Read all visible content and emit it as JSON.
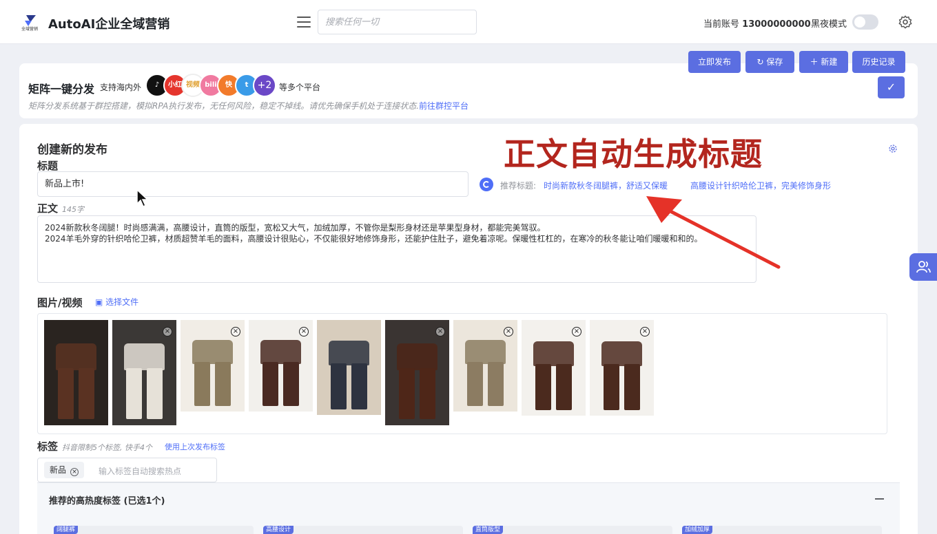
{
  "header": {
    "app_title": "AutoAI企业全域营销",
    "search_placeholder": "搜索任何一切",
    "account_label": "当前账号",
    "account_number": "13000000000",
    "dark_mode_label": "黑夜模式",
    "dark_mode_on": false
  },
  "toolbar": {
    "publish_now": "立即发布",
    "save": "保存",
    "new": "新建",
    "history": "历史记录"
  },
  "matrix": {
    "title": "矩阵一键分发",
    "subtitle_prefix": "支持海内外",
    "subtitle_suffix": "等多个平台",
    "more_count": "+2",
    "description": "矩阵分发系统基于群控搭建，模拟RPA执行发布，无任何风险，稳定不掉线。请优先确保手机处于连接状态.",
    "link": "前往群控平台",
    "platforms": [
      {
        "name": "tiktok-icon",
        "text": "♪",
        "color": "#111111"
      },
      {
        "name": "xiaohongshu-icon",
        "text": "小红",
        "color": "#e5352d"
      },
      {
        "name": "weixin-video-icon",
        "text": "视频",
        "color": "#ffffff"
      },
      {
        "name": "bilibili-icon",
        "text": "bili",
        "color": "#f07aa0"
      },
      {
        "name": "kuaishou-icon",
        "text": "快",
        "color": "#f27b2b"
      },
      {
        "name": "twitter-icon",
        "text": "t",
        "color": "#3a9be8"
      },
      {
        "name": "more-platforms-icon",
        "text": "+2",
        "color": "#6b48c7"
      }
    ]
  },
  "form": {
    "heading": "创建新的发布",
    "title_label": "标题",
    "title_value": "新品上市!",
    "recommend_label": "推荐标题:",
    "recommended_titles": [
      "时尚新款秋冬阔腿裤，舒适又保暖",
      "高腰设计针织哈伦卫裤，完美修饰身形"
    ],
    "body_label": "正文",
    "body_count": "145字",
    "body_lines": [
      "2024新款秋冬阔腿！时尚感满满，高腰设计，直筒的版型，宽松又大气，加绒加厚，不管你是梨形身材还是苹果型身材，都能完美驾驭。",
      "2024羊毛外穿的针织哈伦卫裤，材质超赞羊毛的面料，高腰设计很贴心，不仅能很好地修饰身形，还能护住肚子，避免着凉呢。保暖性杠杠的，在寒冷的秋冬能让咱们暖暖和和的。"
    ],
    "media_label": "图片/视频",
    "choose_file": "选择文件",
    "tags_label": "标签",
    "tags_note": "抖音限制5个标签, 快手4个",
    "use_last_tags": "使用上次发布标签",
    "tags": [
      "新品"
    ],
    "tag_placeholder": "输入标签自动搜索热点",
    "hot_tags_title": "推荐的高热度标签 (已选1个)",
    "hot_tags": [
      "阔腿裤",
      "高腰设计",
      "直筒版型",
      "加绒加厚"
    ]
  },
  "annotation": {
    "overlay_text": "正文自动生成标题"
  },
  "thumbnails": [
    {
      "name": "thumb-brown-wide-pants",
      "bg": "#2a2420",
      "fg": "#5a3222",
      "close": false
    },
    {
      "name": "thumb-cream-wide-pants",
      "bg": "#3b3836",
      "fg": "#e6e1d8",
      "close": true
    },
    {
      "name": "thumb-cardigan-set",
      "bg": "#f1ede6",
      "fg": "#8a7a5c",
      "close": true
    },
    {
      "name": "thumb-brown-jacket-set",
      "bg": "#f2f0ec",
      "fg": "#4a2a22",
      "close": true
    },
    {
      "name": "thumb-dark-pants-coat",
      "bg": "#d8cdbd",
      "fg": "#2e3340",
      "close": false
    },
    {
      "name": "thumb-brown-flare-pants",
      "bg": "#3a3432",
      "fg": "#4e2618",
      "close": true
    },
    {
      "name": "thumb-khaki-joggers",
      "bg": "#ece6dc",
      "fg": "#8c7c62",
      "close": true
    },
    {
      "name": "thumb-cream-set-a",
      "bg": "#f3f1ed",
      "fg": "#4b2a1e",
      "close": true
    },
    {
      "name": "thumb-cream-set-b",
      "bg": "#f3f1ed",
      "fg": "#4b2a1e",
      "close": true
    }
  ]
}
